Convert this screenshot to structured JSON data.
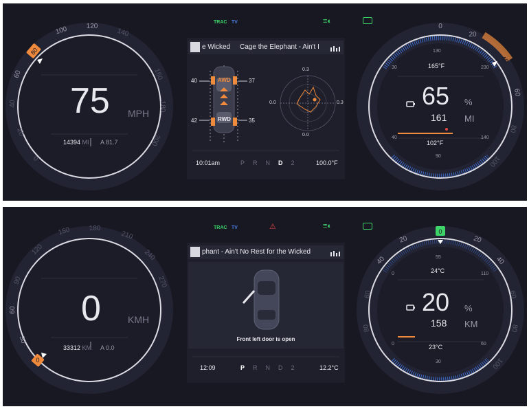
{
  "top": {
    "indicators": {
      "trac": "TRAC",
      "tv": "TV"
    },
    "speed": {
      "value": "75",
      "unit": "MPH",
      "odometer": "14394",
      "odo_unit": "MI",
      "trip": "A 81.7",
      "ticks": [
        "0",
        "20",
        "40",
        "60",
        "80",
        "100",
        "120",
        "140"
      ]
    },
    "media": {
      "text": "e Wicked     Cage the Elephant - Ain't I"
    },
    "awd": {
      "front_label": "AWD",
      "rear_label": "RWD",
      "tire_fl": "40",
      "tire_fr": "37",
      "tire_rl": "42",
      "tire_rr": "35"
    },
    "gforce": {
      "top": "0.3",
      "left": "0.0",
      "right": "0.3",
      "bottom": "0.0"
    },
    "status": {
      "time": "10:01am",
      "gears": [
        "P",
        "R",
        "N",
        "D",
        "2"
      ],
      "active_gear": "D",
      "temp": "100.0°F"
    },
    "battery": {
      "value": "65",
      "pct": "%",
      "range": "161",
      "range_unit": "MI",
      "temp_top": "165°F",
      "temp_bottom": "102°F",
      "scale_top": "130",
      "scale_bottom": "90",
      "scale_tl": "30",
      "scale_tr": "230",
      "scale_bl": "40",
      "scale_br": "140",
      "ticks": [
        "0",
        "20",
        "40",
        "60",
        "80",
        "100"
      ]
    }
  },
  "bottom": {
    "indicators": {
      "trac": "TRAC",
      "tv": "TV"
    },
    "speed": {
      "value": "0",
      "unit": "KMH",
      "odometer": "33312",
      "odo_unit": "KM",
      "trip": "A 0.0",
      "ticks": [
        "0",
        "30",
        "60",
        "90",
        "120",
        "150",
        "180"
      ]
    },
    "media": {
      "text": "phant - Ain't No Rest for the Wicked"
    },
    "door_message": "Front left door is open",
    "status": {
      "time": "12:09",
      "gears": [
        "P",
        "R",
        "N",
        "D",
        "2"
      ],
      "active_gear": "P",
      "temp": "12.2°C"
    },
    "battery": {
      "value": "20",
      "pct": "%",
      "range": "158",
      "range_unit": "KM",
      "temp_top": "24°C",
      "temp_bottom": "23°C",
      "scale_top": "55",
      "scale_bottom": "30",
      "scale_tl": "0",
      "scale_tr": "110",
      "scale_bl": "0",
      "scale_br": "60",
      "top_badge": "0",
      "ticks": [
        "20",
        "40",
        "60",
        "80",
        "100"
      ],
      "ticks_left": [
        "20",
        "40",
        "60",
        "80"
      ]
    }
  },
  "colors": {
    "accent": "#f08a3c",
    "background": "#171821",
    "blue": "#4a7de0",
    "green": "#3ed46a",
    "red": "#e04646"
  }
}
